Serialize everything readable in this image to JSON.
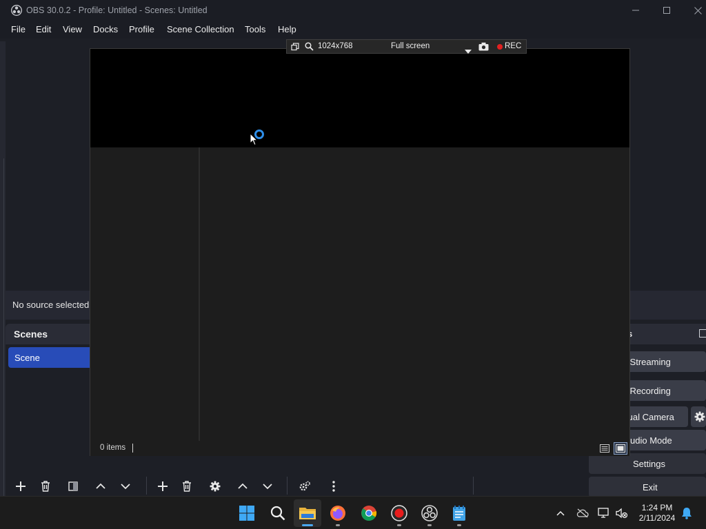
{
  "window": {
    "title": "OBS 30.0.2 - Profile: Untitled - Scenes: Untitled"
  },
  "menubar": {
    "items": [
      "File",
      "Edit",
      "View",
      "Docks",
      "Profile",
      "Scene Collection",
      "Tools",
      "Help"
    ]
  },
  "source_bar": {
    "no_source_text": "No source selected"
  },
  "scenes_dock": {
    "title": "Scenes",
    "items": [
      "Scene"
    ]
  },
  "controls_dock": {
    "title_partial": "s",
    "buttons": {
      "start_streaming": "rt Streaming",
      "start_recording": "rt Recording",
      "virtual_camera": "tual Camera",
      "studio_mode": "udio Mode",
      "settings": "Settings",
      "exit": "Exit"
    }
  },
  "screenshot_tool": {
    "resolution": "1024x768",
    "mode": "Full screen",
    "rec_label": "REC",
    "status_items": "0 items"
  },
  "taskbar": {
    "time": "1:24 PM",
    "date": "2/11/2024"
  },
  "colors": {
    "accent_scene": "#284cb8",
    "rec_dot": "#e22020",
    "spinner": "#2e8ee8",
    "background": "#1d1f26"
  },
  "icons": {
    "titlebar": "obs-logo-icon",
    "scene_toolbar": [
      "plus-icon",
      "trash-icon",
      "filter-icon",
      "arrow-up-icon",
      "arrow-down-icon"
    ],
    "source_toolbar": [
      "plus-icon",
      "trash-icon",
      "gear-icon",
      "arrow-up-icon",
      "arrow-down-icon"
    ],
    "mixer_toolbar": [
      "advanced-audio-icon",
      "kebab-menu-icon"
    ],
    "taskbar_apps": [
      "windows-start-icon",
      "search-icon",
      "file-explorer-icon",
      "firefox-icon",
      "chrome-icon",
      "record-app-icon",
      "obs-icon",
      "notepad-icon"
    ],
    "tray": [
      "chevron-up-icon",
      "cloud-off-icon",
      "network-icon",
      "speaker-muted-icon",
      "notification-bell-icon"
    ]
  }
}
